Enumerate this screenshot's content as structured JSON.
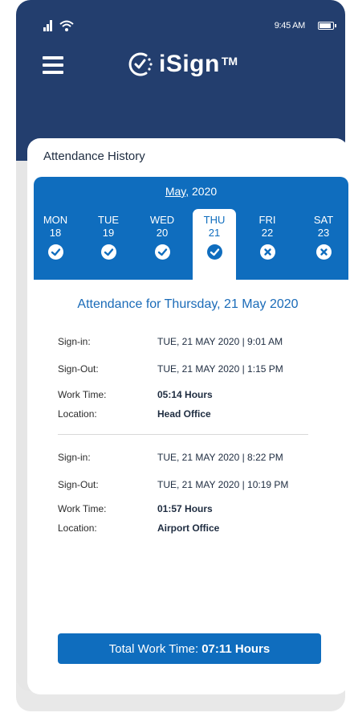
{
  "status_bar": {
    "time": "9:45 AM"
  },
  "app": {
    "logo_text": "iSign",
    "logo_tm": "TM"
  },
  "card": {
    "title": "Attendance History"
  },
  "calendar": {
    "month": "May,",
    "year": " 2020",
    "days": [
      {
        "name": "MON",
        "num": "18",
        "status": "present"
      },
      {
        "name": "TUE",
        "num": "19",
        "status": "present"
      },
      {
        "name": "WED",
        "num": "20",
        "status": "present"
      },
      {
        "name": "THU",
        "num": "21",
        "status": "present",
        "selected": true
      },
      {
        "name": "FRI",
        "num": "22",
        "status": "absent"
      },
      {
        "name": "SAT",
        "num": "23",
        "status": "absent"
      }
    ]
  },
  "attendance": {
    "heading": "Attendance for Thursday, 21 May 2020",
    "sessions": [
      {
        "signin_label": "Sign-in:",
        "signin_value": "TUE, 21 MAY 2020 | 9:01 AM",
        "signout_label": "Sign-Out:",
        "signout_value": "TUE, 21 MAY 2020 | 1:15 PM",
        "worktime_label": "Work Time:",
        "worktime_value": "05:14 Hours",
        "location_label": "Location:",
        "location_value": "Head Office"
      },
      {
        "signin_label": "Sign-in:",
        "signin_value": "TUE, 21 MAY 2020 | 8:22 PM",
        "signout_label": "Sign-Out:",
        "signout_value": "TUE, 21 MAY 2020 | 10:19 PM",
        "worktime_label": "Work Time:",
        "worktime_value": "01:57 Hours",
        "location_label": "Location:",
        "location_value": "Airport Office"
      }
    ]
  },
  "total": {
    "label": "Total Work Time:",
    "value": "07:11 Hours"
  },
  "colors": {
    "header": "#233e6e",
    "accent": "#0f6dbe",
    "heading": "#1a6bb8"
  }
}
